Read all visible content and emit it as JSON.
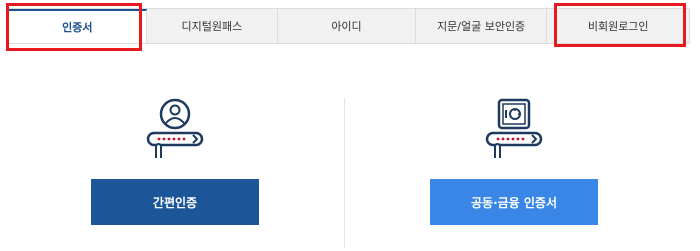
{
  "tabs": [
    {
      "label": "인증서",
      "active": true
    },
    {
      "label": "디지털원패스",
      "active": false
    },
    {
      "label": "아이디",
      "active": false
    },
    {
      "label": "지문/얼굴 보안인증",
      "active": false
    },
    {
      "label": "비회원로그인",
      "active": false
    }
  ],
  "options": {
    "simple_auth": {
      "label": "간편인증",
      "icon": "user-card-icon",
      "color": "#1c5699"
    },
    "certificate": {
      "label": "공동·금융 인증서",
      "icon": "safe-card-icon",
      "color": "#3a86e6"
    }
  },
  "colors": {
    "accent": "#1a4e8c",
    "highlight": "#e8181f",
    "icon_dark": "#1e3a5f",
    "icon_red": "#c8102e"
  }
}
